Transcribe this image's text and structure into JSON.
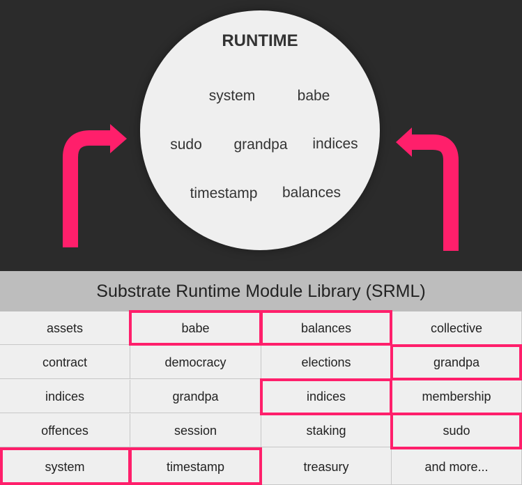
{
  "runtime": {
    "title": "RUNTIME",
    "modules": [
      "system",
      "babe",
      "sudo",
      "grandpa",
      "indices",
      "timestamp",
      "balances"
    ]
  },
  "library": {
    "title": "Substrate Runtime Module Library (SRML)",
    "rows": [
      [
        "assets",
        "babe",
        "balances",
        "collective"
      ],
      [
        "contract",
        "democracy",
        "elections",
        "grandpa"
      ],
      [
        "indices",
        "grandpa",
        "indices",
        "membership"
      ],
      [
        "offences",
        "session",
        "staking",
        "sudo"
      ],
      [
        "system",
        "timestamp",
        "treasury",
        "and more..."
      ]
    ],
    "highlighted": [
      "babe",
      "balances",
      "grandpa",
      "indices",
      "sudo",
      "system",
      "timestamp"
    ]
  },
  "colors": {
    "accent": "#ff1f6b",
    "dark_bg": "#2b2b2b",
    "circle": "#efefef",
    "header": "#bdbdbd"
  }
}
